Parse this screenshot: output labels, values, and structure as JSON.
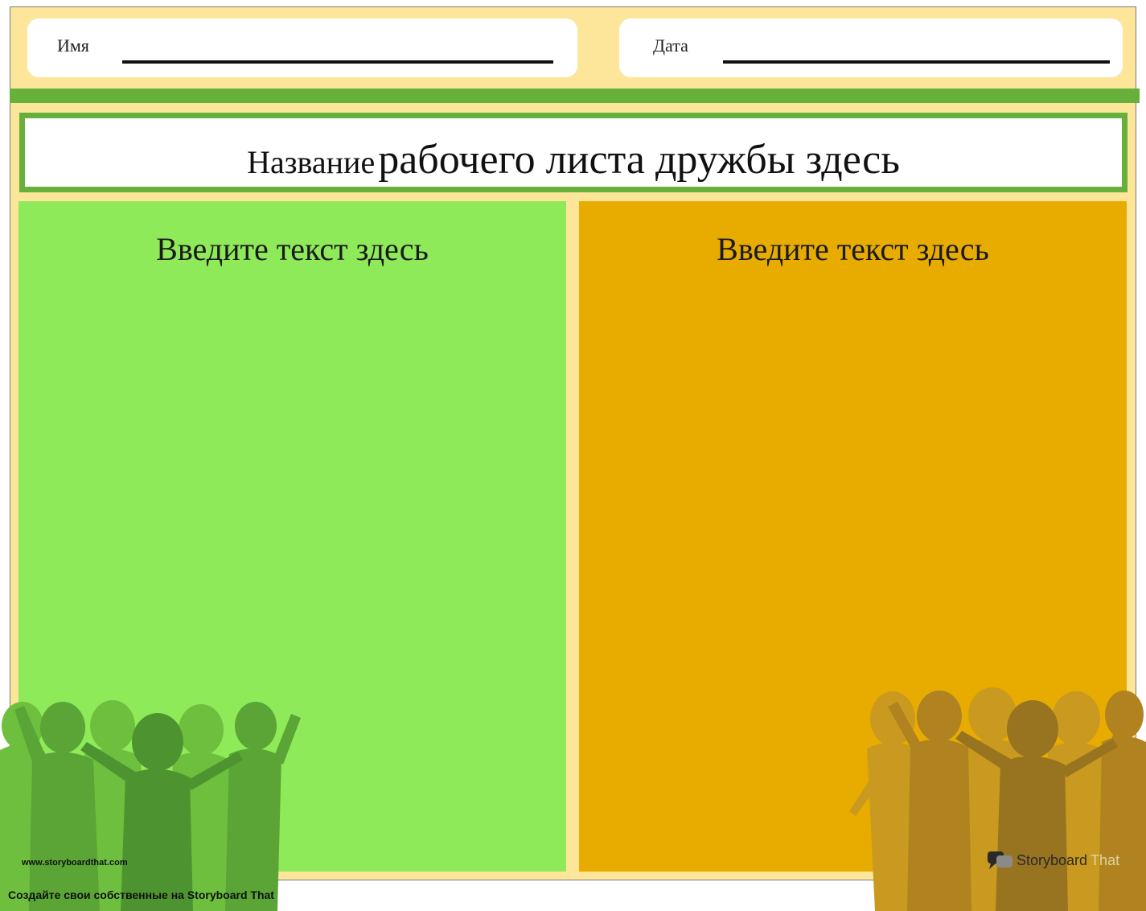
{
  "header": {
    "name_label": "Имя",
    "date_label": "Дата"
  },
  "title": {
    "part1": "Название",
    "part2": "рабочего листа дружбы здесь"
  },
  "panels": [
    {
      "heading": "Введите текст здесь",
      "color": "#8fea59"
    },
    {
      "heading": "Введите текст здесь",
      "color": "#e8ac00"
    }
  ],
  "footer": {
    "url": "www.storyboardthat.com",
    "credit": "Создайте свои собственные на Storyboard That"
  },
  "logo": {
    "word1": "Storyboard",
    "word2": "That"
  },
  "colors": {
    "sheet_background": "#fde59a",
    "accent_green": "#66b03b"
  }
}
